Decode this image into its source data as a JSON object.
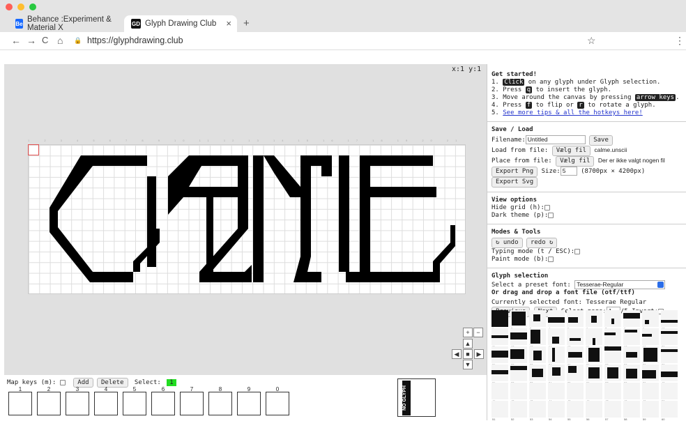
{
  "browser": {
    "tabs": [
      {
        "label": "Behance :Experiment & Material X",
        "favicon": "Be",
        "favicon_color": "#1769ff"
      },
      {
        "label": "Glyph Drawing Club",
        "favicon": "GD",
        "favicon_color": "#111111",
        "close": "×"
      }
    ],
    "new_tab": "+",
    "url": "https://glyphdrawing.club",
    "star": "☆",
    "menu": "⋮",
    "nav_back": "←",
    "nav_forward": "→",
    "nav_reload": "C",
    "nav_home": "⌂",
    "lock": "🔒"
  },
  "canvas": {
    "coords": "x:1 y:1",
    "zoom_in": "+",
    "zoom_out": "−",
    "arrows": [
      "▲",
      "◀",
      "■",
      "▶",
      "▼"
    ]
  },
  "bottom": {
    "map_keys_label": "Map keys (m):",
    "add_label": "Add",
    "delete_label": "Delete",
    "select_label": "Select:",
    "select_value": "1",
    "slot_numbers": [
      "1",
      "2",
      "3",
      "4",
      "5",
      "6",
      "7",
      "8",
      "9",
      "0"
    ],
    "preview_text": "NO GLYPH"
  },
  "panel": {
    "get_started": "Get started!",
    "step1a": "1. ",
    "step1_kbd": "Click",
    "step1b": " on any glyph under Glyph selection.",
    "step2a": "2. Press ",
    "step2_kbd": "q",
    "step2b": " to insert the glyph.",
    "step3a": "3. Move around the canvas by pressing ",
    "step3_kbd": "arrow keys",
    "step3b": ".",
    "step4a": "4. Press ",
    "step4_kbd1": "f",
    "step4b": " to flip or ",
    "step4_kbd2": "r",
    "step4c": " to rotate a glyph.",
    "step5a": "5. ",
    "step5_link": "See more tips & all the hotkeys here!",
    "save_load": "Save / Load",
    "filename_label": "Filename:",
    "filename_value": "Untitled",
    "save_btn": "Save",
    "load_label": "Load from file:",
    "load_btn": "Vælg fil",
    "load_file": "calme.unscii",
    "place_label": "Place from file:",
    "place_btn": "Vælg fil",
    "place_file": "Der er ikke valgt nogen fil",
    "export_png": "Export Png",
    "size_label": "Size:",
    "size_value": "5",
    "size_px": "(8700px × 4200px)",
    "export_svg": "Export Svg",
    "view_options": "View options",
    "hide_grid": "Hide grid (h):",
    "dark_theme": "Dark theme (p):",
    "modes_tools": "Modes & Tools",
    "undo": "↻ undo",
    "redo": "redo ↻",
    "typing_mode": "Typing mode (t / ESC):",
    "paint_mode": "Paint mode (b):",
    "glyph_selection": "Glyph selection",
    "preset_label": "Select a preset font:",
    "preset_value": "Tesserae-Regular",
    "drag_drop": "Or drag and drop a font file (otf/ttf)",
    "current_font": "Currently selected font: Tesserae Regular",
    "previous": "Previous",
    "next": "Next",
    "select_page": "Select page:",
    "page_value": "1",
    "page_total": "/5",
    "invert": "Invert:"
  },
  "colors": {
    "accent_green": "#22dd22",
    "cursor_red": "#e25050",
    "canvas_bg": "#e0e0e0"
  }
}
